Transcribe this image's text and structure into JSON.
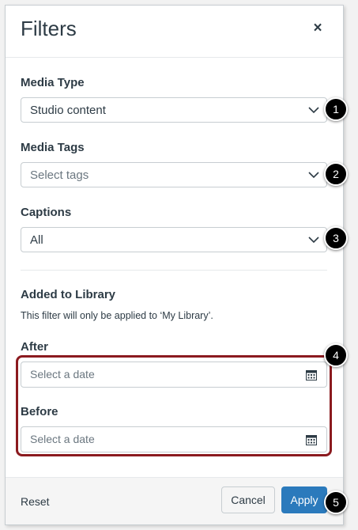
{
  "header": {
    "title": "Filters",
    "close_label": "×"
  },
  "media_type": {
    "label": "Media Type",
    "value": "Studio content"
  },
  "media_tags": {
    "label": "Media Tags",
    "placeholder": "Select tags"
  },
  "captions": {
    "label": "Captions",
    "value": "All"
  },
  "added_to_library": {
    "label": "Added to Library",
    "note": "This filter will only be applied to ‘My Library’.",
    "after": {
      "label": "After",
      "placeholder": "Select a date"
    },
    "before": {
      "label": "Before",
      "placeholder": "Select a date"
    }
  },
  "footer": {
    "reset_label": "Reset",
    "cancel_label": "Cancel",
    "apply_label": "Apply"
  },
  "callouts": [
    "1",
    "2",
    "3",
    "4",
    "5"
  ],
  "colors": {
    "accent": "#2b7abc",
    "highlight": "#8b1a1f",
    "text": "#2d3b45"
  }
}
